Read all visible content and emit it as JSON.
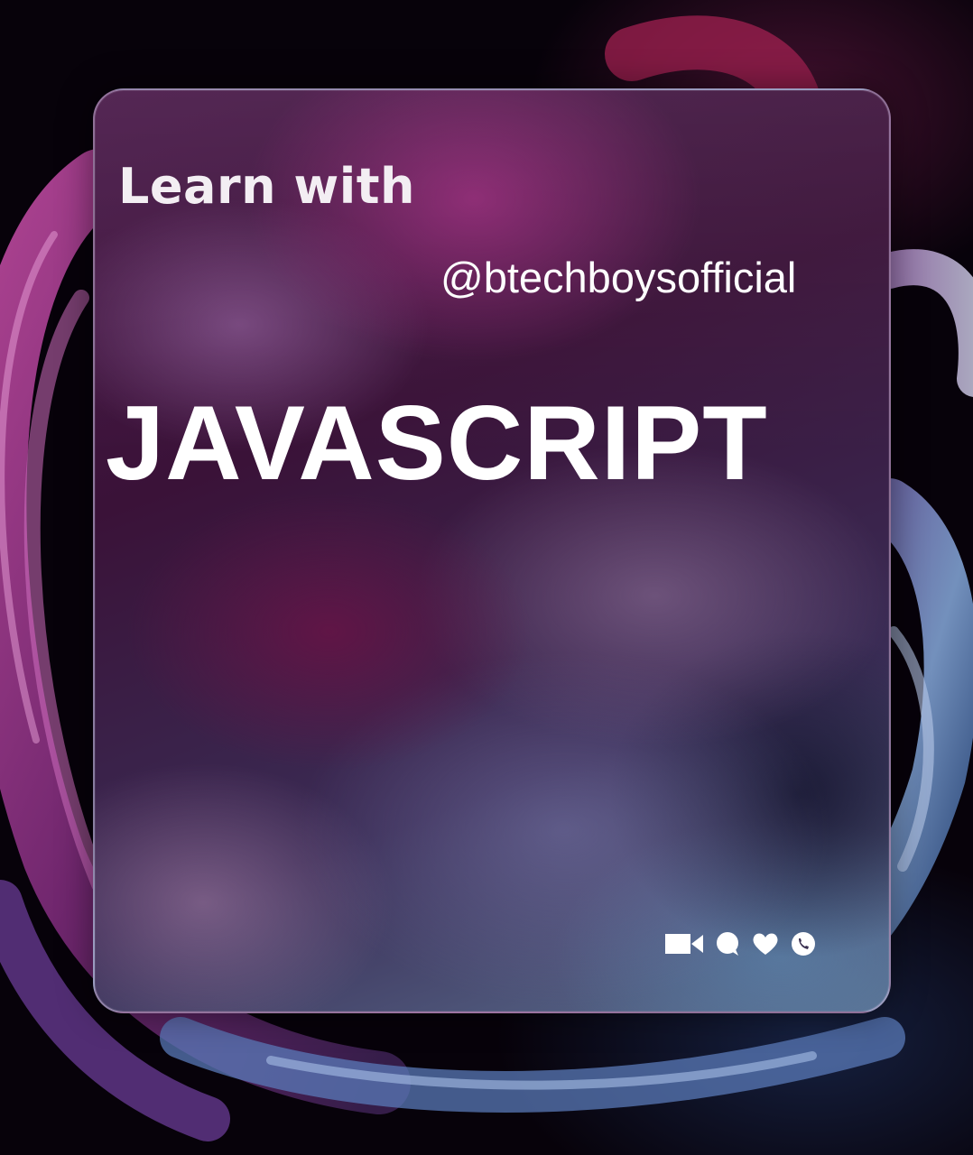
{
  "card": {
    "heading": "Learn with",
    "handle": "@btechboysofficial",
    "title": "JAVASCRIPT"
  },
  "icons": [
    "video-camera-icon",
    "chat-bubble-icon",
    "heart-icon",
    "phone-icon"
  ],
  "colors": {
    "background": "#07020a",
    "text": "#ffffff",
    "accent_magenta": "#8a2a78",
    "accent_blue": "#5a7090"
  }
}
